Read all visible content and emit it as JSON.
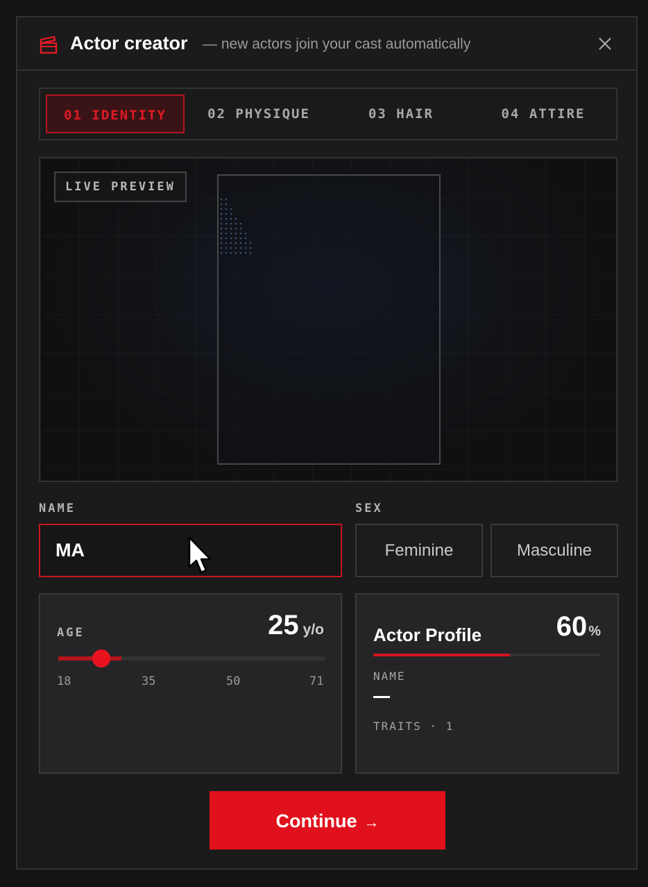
{
  "header": {
    "title": "Actor creator",
    "subtitle": "— new actors join your cast automatically",
    "accent_color": "#e01a25",
    "logo_icon": "clapperboard-icon",
    "close_icon": "close-icon"
  },
  "tabs": [
    {
      "label": "01 IDENTITY",
      "active": true
    },
    {
      "label": "02 PHYSIQUE",
      "active": false
    },
    {
      "label": "03 HAIR",
      "active": false
    },
    {
      "label": "04 ATTIRE",
      "active": false
    }
  ],
  "preview": {
    "badge": "LIVE PREVIEW"
  },
  "identity": {
    "name_label": "NAME",
    "name_value": "MA",
    "sex_label": "SEX",
    "sex_options": [
      "Feminine",
      "Masculine"
    ]
  },
  "age": {
    "label": "AGE",
    "value": "25",
    "unit": "y/o",
    "min": 18,
    "max": 71,
    "ticks": [
      "18",
      "35",
      "50",
      "71"
    ]
  },
  "profile": {
    "title": "Actor Profile",
    "percent": "60",
    "percent_unit": "%",
    "progress": 0.6,
    "name_label": "NAME",
    "name_value": "—",
    "traits_label": "TRAITS · 1"
  },
  "footer": {
    "continue_label": "Continue",
    "continue_icon": "arrow-right-icon",
    "button_color": "#e0111c"
  }
}
